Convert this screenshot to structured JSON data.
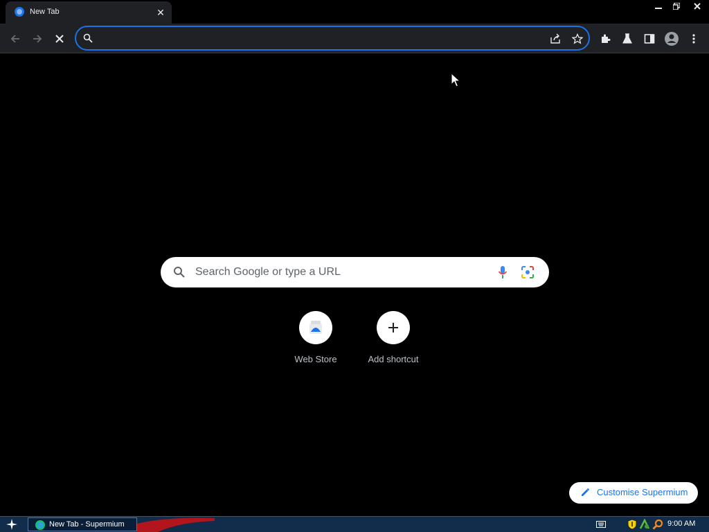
{
  "tab": {
    "title": "New Tab",
    "close": "✕"
  },
  "window_controls": {
    "minimize": "–",
    "restore": "❐",
    "close": "✕"
  },
  "omnibox": {
    "value": "",
    "placeholder": ""
  },
  "ntp": {
    "search_placeholder": "Search Google or type a URL",
    "shortcuts": [
      {
        "label": "Web Store"
      },
      {
        "label": "Add shortcut",
        "icon": "+"
      }
    ],
    "customise_label": "Customise Supermium"
  },
  "taskbar": {
    "task_label": "New Tab - Supermium",
    "clock": "9:00 AM"
  },
  "colors": {
    "accent": "#1a73e8",
    "toolbar_bg": "#202124",
    "page_bg": "#000000",
    "taskbar_bg": "#122c4b"
  },
  "icons": [
    "back-icon",
    "forward-icon",
    "stop-icon",
    "search-icon",
    "share-icon",
    "bookmark-star-icon",
    "extensions-icon",
    "labs-icon",
    "side-panel-icon",
    "profile-icon",
    "menu-icon",
    "mic-icon",
    "lens-icon",
    "pencil-icon",
    "keyboard-icon",
    "shield-icon",
    "network-icon",
    "search-tray-icon",
    "start-icon"
  ]
}
